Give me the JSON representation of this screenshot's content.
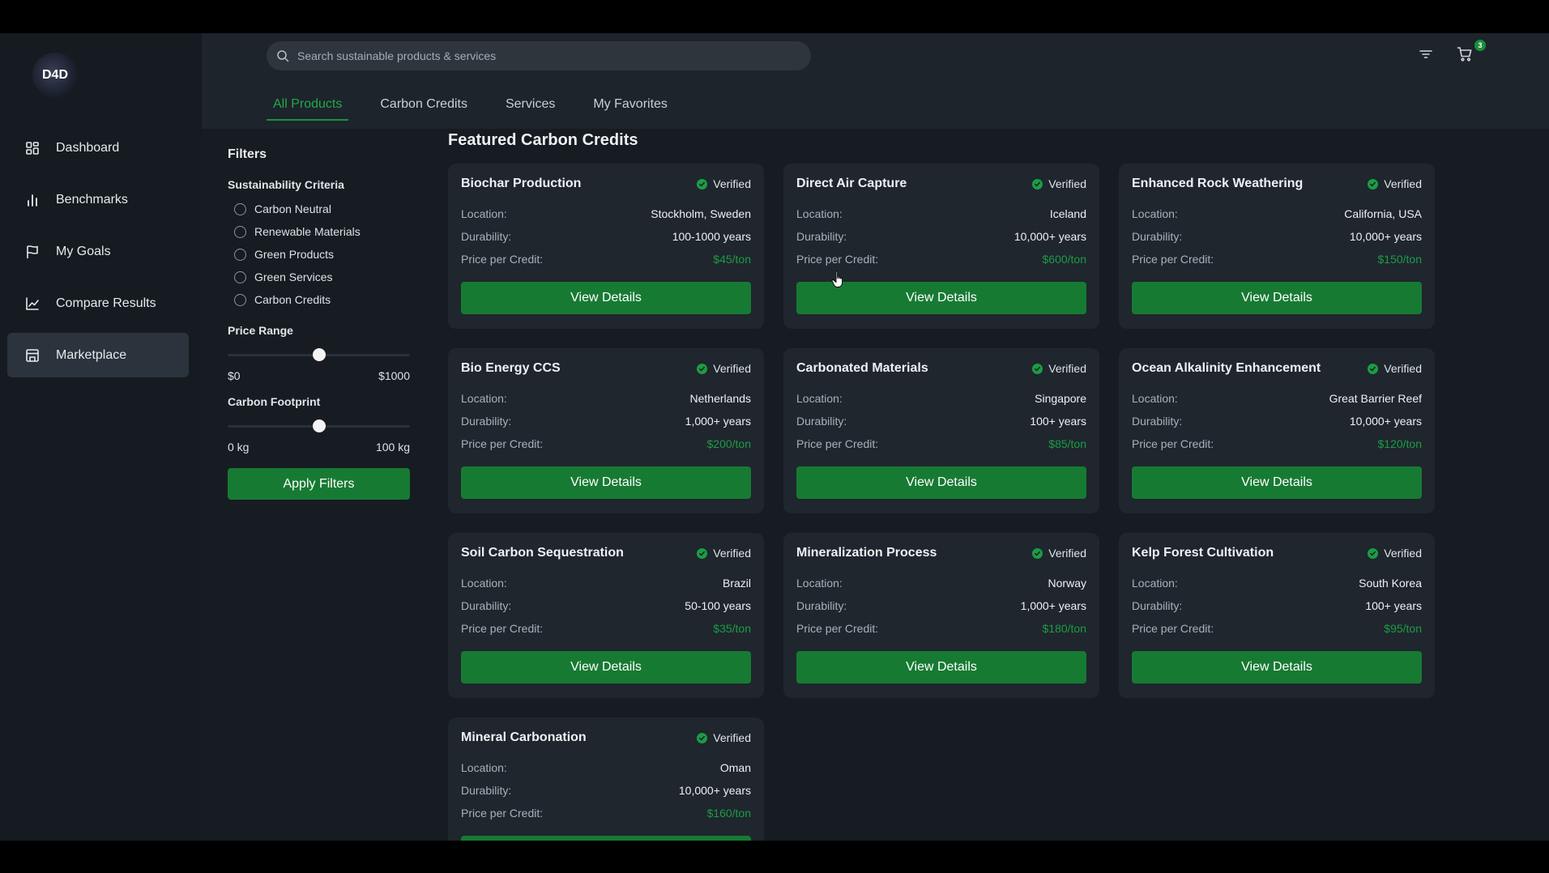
{
  "app": {
    "logo_text": "D4D"
  },
  "sidebar": {
    "items": [
      {
        "label": "Dashboard",
        "icon": "grid-icon",
        "active": false
      },
      {
        "label": "Benchmarks",
        "icon": "bar-chart-icon",
        "active": false
      },
      {
        "label": "My Goals",
        "icon": "flag-icon",
        "active": false
      },
      {
        "label": "Compare Results",
        "icon": "line-chart-icon",
        "active": false
      },
      {
        "label": "Marketplace",
        "icon": "store-icon",
        "active": true
      }
    ]
  },
  "header": {
    "search_placeholder": "Search sustainable products & services",
    "cart_count": "3",
    "tabs": [
      {
        "label": "All Products",
        "active": true
      },
      {
        "label": "Carbon Credits",
        "active": false
      },
      {
        "label": "Services",
        "active": false
      },
      {
        "label": "My Favorites",
        "active": false
      }
    ]
  },
  "filters": {
    "title": "Filters",
    "criteria_title": "Sustainability Criteria",
    "criteria": [
      "Carbon Neutral",
      "Renewable Materials",
      "Green Products",
      "Green Services",
      "Carbon Credits"
    ],
    "price": {
      "title": "Price Range",
      "min_label": "$0",
      "max_label": "$1000",
      "value_fraction": 0.5
    },
    "footprint": {
      "title": "Carbon Footprint",
      "min_label": "0 kg",
      "max_label": "100 kg",
      "value_fraction": 0.5
    },
    "apply_label": "Apply Filters"
  },
  "main": {
    "title": "Featured Carbon Credits",
    "labels": {
      "verified": "Verified",
      "location": "Location:",
      "durability": "Durability:",
      "price": "Price per Credit:",
      "button": "View Details"
    },
    "cards": [
      {
        "title": "Biochar Production",
        "location": "Stockholm, Sweden",
        "durability": "100-1000 years",
        "price": "$45/ton"
      },
      {
        "title": "Direct Air Capture",
        "location": "Iceland",
        "durability": "10,000+ years",
        "price": "$600/ton"
      },
      {
        "title": "Enhanced Rock Weathering",
        "location": "California, USA",
        "durability": "10,000+ years",
        "price": "$150/ton"
      },
      {
        "title": "Bio Energy CCS",
        "location": "Netherlands",
        "durability": "1,000+ years",
        "price": "$200/ton"
      },
      {
        "title": "Carbonated Materials",
        "location": "Singapore",
        "durability": "100+ years",
        "price": "$85/ton"
      },
      {
        "title": "Ocean Alkalinity Enhancement",
        "location": "Great Barrier Reef",
        "durability": "10,000+ years",
        "price": "$120/ton"
      },
      {
        "title": "Soil Carbon Sequestration",
        "location": "Brazil",
        "durability": "50-100 years",
        "price": "$35/ton"
      },
      {
        "title": "Mineralization Process",
        "location": "Norway",
        "durability": "1,000+ years",
        "price": "$180/ton"
      },
      {
        "title": "Kelp Forest Cultivation",
        "location": "South Korea",
        "durability": "100+ years",
        "price": "$95/ton"
      },
      {
        "title": "Mineral Carbonation",
        "location": "Oman",
        "durability": "10,000+ years",
        "price": "$160/ton"
      }
    ]
  },
  "colors": {
    "accent": "#177a33",
    "price": "#1c9c45",
    "background": "#161c22",
    "card": "#1f262d"
  }
}
